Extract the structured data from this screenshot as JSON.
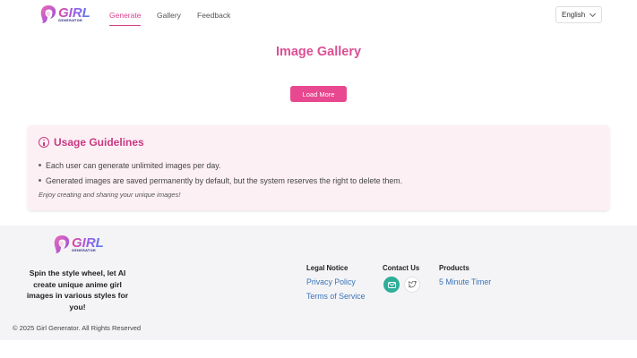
{
  "header": {
    "logo": {
      "word": "GIRL",
      "sub": "GENERATOR"
    },
    "nav": [
      {
        "label": "Generate",
        "active": true
      },
      {
        "label": "Gallery",
        "active": false
      },
      {
        "label": "Feedback",
        "active": false
      }
    ],
    "language": {
      "selected": "English"
    }
  },
  "main": {
    "title": "Image Gallery",
    "load_more_label": "Load More"
  },
  "guidelines": {
    "title": "Usage Guidelines",
    "items": [
      "Each user can generate unlimited images per day.",
      "Generated images are saved permanently by default, but the system reserves the right to delete them."
    ],
    "note": "Enjoy creating and sharing your unique images!"
  },
  "footer": {
    "logo": {
      "word": "GIRL",
      "sub": "GENERATOR"
    },
    "tagline": "Spin the style wheel, let AI create unique anime girl images in various styles for you!",
    "legal": {
      "title": "Legal Notice",
      "links": [
        "Privacy Policy",
        "Terms of Service"
      ]
    },
    "contact": {
      "title": "Contact Us",
      "icons": [
        "mail-icon",
        "twitter-icon"
      ]
    },
    "products": {
      "title": "Products",
      "links": [
        "5 Minute Timer"
      ]
    },
    "copyright": "© 2025 Girl Generator. All Rights Reserved"
  },
  "colors": {
    "accent": "#e8488f",
    "title": "#db4f94",
    "guide_bg": "#fdf0f5",
    "link": "#3b74b8",
    "contact_green": "#2fae9a"
  }
}
